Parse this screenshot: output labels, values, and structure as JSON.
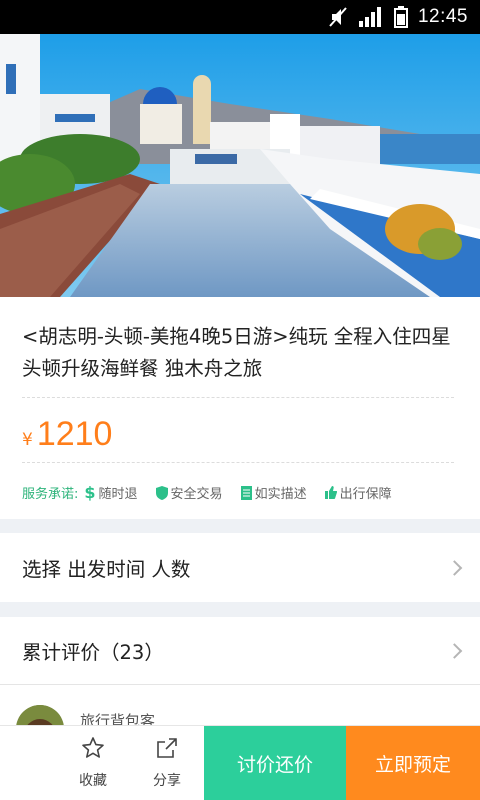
{
  "status_bar": {
    "time": "12:45",
    "icons": [
      "mute-icon",
      "signal-icon",
      "battery-icon"
    ]
  },
  "product": {
    "title": "<胡志明-头顿-美拖4晚5日游>纯玩 全程入住四星 头顿升级海鲜餐 独木舟之旅",
    "price_symbol": "¥",
    "price": "1210"
  },
  "promises": {
    "label": "服务承诺:",
    "items": [
      {
        "icon": "dollar-icon",
        "text": "随时退"
      },
      {
        "icon": "shield-icon",
        "text": "安全交易"
      },
      {
        "icon": "document-icon",
        "text": "如实描述"
      },
      {
        "icon": "thumbs-up-icon",
        "text": "出行保障"
      }
    ]
  },
  "options_row": {
    "label": "选择 出发时间 人数"
  },
  "reviews_row": {
    "label": "累计评价（23）"
  },
  "review_preview": {
    "reviewer": "旅行背包客"
  },
  "bottom_bar": {
    "favorite_label": "收藏",
    "share_label": "分享",
    "bargain_label": "讨价还价",
    "book_label": "立即预定"
  },
  "colors": {
    "price": "#ff7e1a",
    "accent_green": "#2ccf9b",
    "accent_orange": "#ff8a1e",
    "promise_green": "#2db37a"
  }
}
